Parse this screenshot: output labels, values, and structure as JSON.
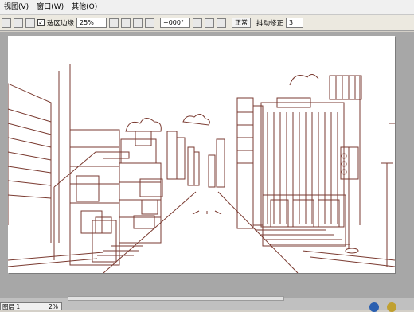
{
  "menu": {
    "view": "视图(V)",
    "window": "窗口(W)",
    "other": "其他(O)"
  },
  "toolbar": {
    "snap_label": "选区边缘",
    "snap_checked": "✓",
    "zoom_value": "25%",
    "rotation_value": "+000°",
    "normal_button": "正常",
    "stabilizer_label": "抖动修正",
    "stabilizer_value": "3"
  },
  "status": {
    "panel_label": "图层 1",
    "panel_value": "2%"
  },
  "colors": {
    "line_art": "#7a3a30",
    "workspace": "#a7a7a7",
    "canvas": "#ffffff"
  }
}
